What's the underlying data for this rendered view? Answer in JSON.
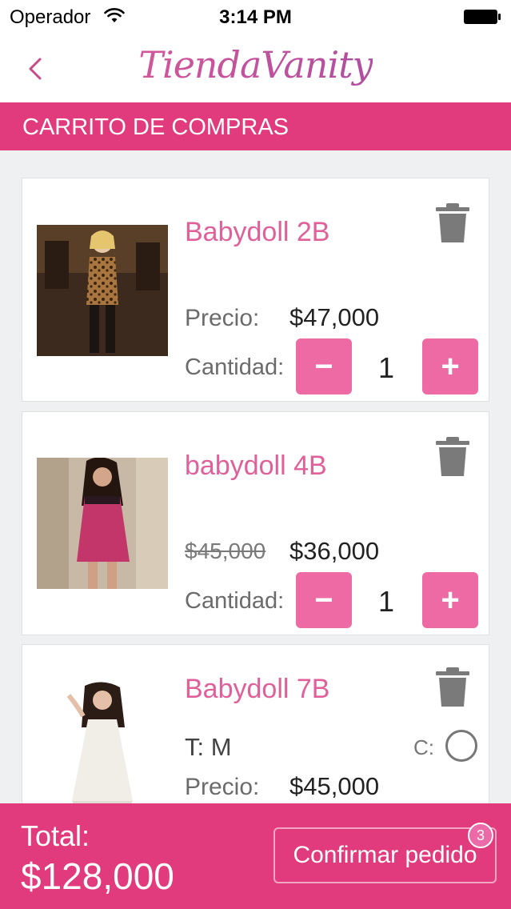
{
  "status_bar": {
    "carrier": "Operador",
    "time": "3:14 PM"
  },
  "nav": {
    "logo_text": "TiendaVanity"
  },
  "section": {
    "title": "CARRITO DE COMPRAS"
  },
  "items": [
    {
      "name": "Babydoll 2B",
      "price_label": "Precio:",
      "price": "$47,000",
      "qty_label": "Cantidad:",
      "quantity": "1",
      "minus": "−",
      "plus": "+"
    },
    {
      "name": "babydoll 4B",
      "old_price": "$45,000",
      "price": "$36,000",
      "qty_label": "Cantidad:",
      "quantity": "1",
      "minus": "−",
      "plus": "+"
    },
    {
      "name": "Babydoll 7B",
      "size": "T: M",
      "color_label": "C:",
      "price_label": "Precio:",
      "price": "$45,000"
    }
  ],
  "footer": {
    "total_label": "Total:",
    "total_value": "$128,000",
    "confirm_label": "Confirmar pedido",
    "badge_count": "3"
  },
  "colors": {
    "brand": "#e23b7d",
    "accent": "#ed6aa4",
    "product_name": "#e0609a",
    "icon_gray": "#7a7a7a"
  },
  "icons": [
    "wifi-icon",
    "battery-icon",
    "back-chevron-icon",
    "trash-icon"
  ]
}
